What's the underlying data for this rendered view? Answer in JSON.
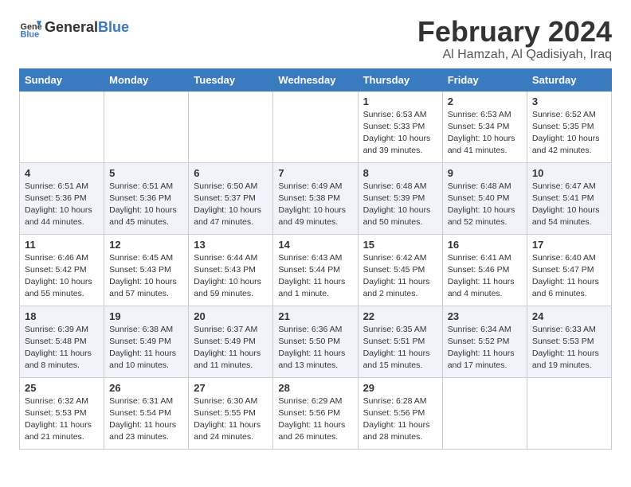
{
  "logo": {
    "general": "General",
    "blue": "Blue"
  },
  "header": {
    "month": "February 2024",
    "location": "Al Hamzah, Al Qadisiyah, Iraq"
  },
  "weekdays": [
    "Sunday",
    "Monday",
    "Tuesday",
    "Wednesday",
    "Thursday",
    "Friday",
    "Saturday"
  ],
  "weeks": [
    [
      {
        "day": "",
        "info": ""
      },
      {
        "day": "",
        "info": ""
      },
      {
        "day": "",
        "info": ""
      },
      {
        "day": "",
        "info": ""
      },
      {
        "day": "1",
        "info": "Sunrise: 6:53 AM\nSunset: 5:33 PM\nDaylight: 10 hours\nand 39 minutes."
      },
      {
        "day": "2",
        "info": "Sunrise: 6:53 AM\nSunset: 5:34 PM\nDaylight: 10 hours\nand 41 minutes."
      },
      {
        "day": "3",
        "info": "Sunrise: 6:52 AM\nSunset: 5:35 PM\nDaylight: 10 hours\nand 42 minutes."
      }
    ],
    [
      {
        "day": "4",
        "info": "Sunrise: 6:51 AM\nSunset: 5:36 PM\nDaylight: 10 hours\nand 44 minutes."
      },
      {
        "day": "5",
        "info": "Sunrise: 6:51 AM\nSunset: 5:36 PM\nDaylight: 10 hours\nand 45 minutes."
      },
      {
        "day": "6",
        "info": "Sunrise: 6:50 AM\nSunset: 5:37 PM\nDaylight: 10 hours\nand 47 minutes."
      },
      {
        "day": "7",
        "info": "Sunrise: 6:49 AM\nSunset: 5:38 PM\nDaylight: 10 hours\nand 49 minutes."
      },
      {
        "day": "8",
        "info": "Sunrise: 6:48 AM\nSunset: 5:39 PM\nDaylight: 10 hours\nand 50 minutes."
      },
      {
        "day": "9",
        "info": "Sunrise: 6:48 AM\nSunset: 5:40 PM\nDaylight: 10 hours\nand 52 minutes."
      },
      {
        "day": "10",
        "info": "Sunrise: 6:47 AM\nSunset: 5:41 PM\nDaylight: 10 hours\nand 54 minutes."
      }
    ],
    [
      {
        "day": "11",
        "info": "Sunrise: 6:46 AM\nSunset: 5:42 PM\nDaylight: 10 hours\nand 55 minutes."
      },
      {
        "day": "12",
        "info": "Sunrise: 6:45 AM\nSunset: 5:43 PM\nDaylight: 10 hours\nand 57 minutes."
      },
      {
        "day": "13",
        "info": "Sunrise: 6:44 AM\nSunset: 5:43 PM\nDaylight: 10 hours\nand 59 minutes."
      },
      {
        "day": "14",
        "info": "Sunrise: 6:43 AM\nSunset: 5:44 PM\nDaylight: 11 hours\nand 1 minute."
      },
      {
        "day": "15",
        "info": "Sunrise: 6:42 AM\nSunset: 5:45 PM\nDaylight: 11 hours\nand 2 minutes."
      },
      {
        "day": "16",
        "info": "Sunrise: 6:41 AM\nSunset: 5:46 PM\nDaylight: 11 hours\nand 4 minutes."
      },
      {
        "day": "17",
        "info": "Sunrise: 6:40 AM\nSunset: 5:47 PM\nDaylight: 11 hours\nand 6 minutes."
      }
    ],
    [
      {
        "day": "18",
        "info": "Sunrise: 6:39 AM\nSunset: 5:48 PM\nDaylight: 11 hours\nand 8 minutes."
      },
      {
        "day": "19",
        "info": "Sunrise: 6:38 AM\nSunset: 5:49 PM\nDaylight: 11 hours\nand 10 minutes."
      },
      {
        "day": "20",
        "info": "Sunrise: 6:37 AM\nSunset: 5:49 PM\nDaylight: 11 hours\nand 11 minutes."
      },
      {
        "day": "21",
        "info": "Sunrise: 6:36 AM\nSunset: 5:50 PM\nDaylight: 11 hours\nand 13 minutes."
      },
      {
        "day": "22",
        "info": "Sunrise: 6:35 AM\nSunset: 5:51 PM\nDaylight: 11 hours\nand 15 minutes."
      },
      {
        "day": "23",
        "info": "Sunrise: 6:34 AM\nSunset: 5:52 PM\nDaylight: 11 hours\nand 17 minutes."
      },
      {
        "day": "24",
        "info": "Sunrise: 6:33 AM\nSunset: 5:53 PM\nDaylight: 11 hours\nand 19 minutes."
      }
    ],
    [
      {
        "day": "25",
        "info": "Sunrise: 6:32 AM\nSunset: 5:53 PM\nDaylight: 11 hours\nand 21 minutes."
      },
      {
        "day": "26",
        "info": "Sunrise: 6:31 AM\nSunset: 5:54 PM\nDaylight: 11 hours\nand 23 minutes."
      },
      {
        "day": "27",
        "info": "Sunrise: 6:30 AM\nSunset: 5:55 PM\nDaylight: 11 hours\nand 24 minutes."
      },
      {
        "day": "28",
        "info": "Sunrise: 6:29 AM\nSunset: 5:56 PM\nDaylight: 11 hours\nand 26 minutes."
      },
      {
        "day": "29",
        "info": "Sunrise: 6:28 AM\nSunset: 5:56 PM\nDaylight: 11 hours\nand 28 minutes."
      },
      {
        "day": "",
        "info": ""
      },
      {
        "day": "",
        "info": ""
      }
    ]
  ],
  "colors": {
    "header_bg": "#3a7abf",
    "row_even": "#f0f4fa",
    "row_odd": "#ffffff"
  }
}
